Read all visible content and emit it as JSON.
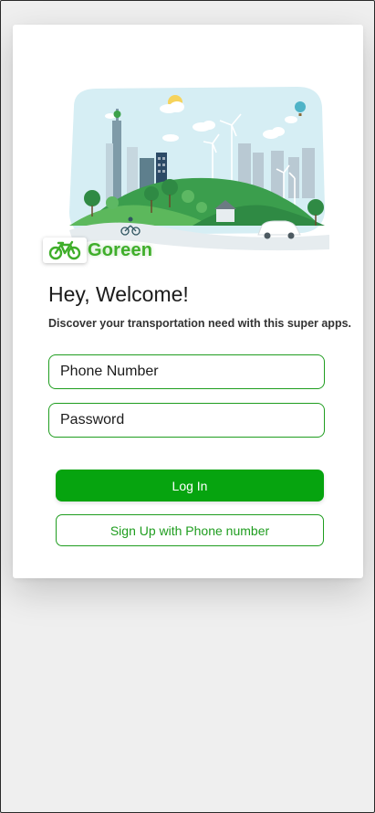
{
  "brand": {
    "name": "Goreen",
    "color": "#3fae2a"
  },
  "welcome": {
    "title": "Hey, Welcome!",
    "subtitle": "Discover your transportation need with this super apps."
  },
  "form": {
    "phone_placeholder": "Phone Number",
    "password_placeholder": "Password"
  },
  "buttons": {
    "login_label": "Log In",
    "signup_label": "Sign Up with Phone number",
    "accent": "#06a40f"
  },
  "icons": {
    "logo": "bicycle-icon",
    "hero": "green-city-illustration"
  }
}
